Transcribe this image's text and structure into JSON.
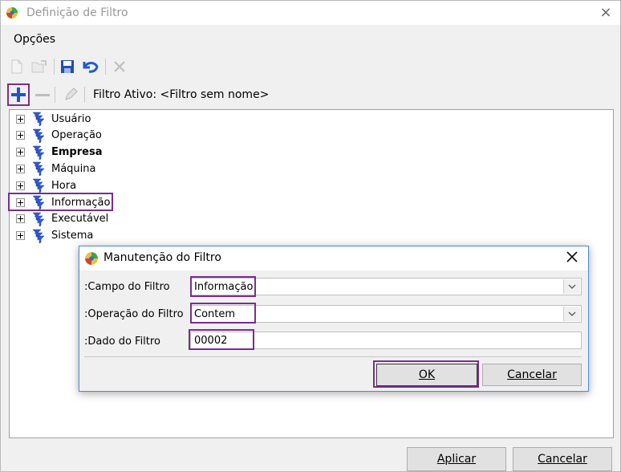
{
  "window": {
    "title": "Definição de Filtro",
    "close_icon": "×"
  },
  "menu": {
    "opcoes": "Opções"
  },
  "toolbar": {
    "icons": [
      "new-doc-icon",
      "open-icon",
      "save-icon",
      "undo-icon",
      "delete-icon"
    ]
  },
  "filter_toolbar": {
    "label": "Filtro Ativo: <Filtro sem nome>"
  },
  "tree": {
    "items": [
      {
        "label": "Usuário",
        "bold": false
      },
      {
        "label": "Operação",
        "bold": false
      },
      {
        "label": "Empresa",
        "bold": true
      },
      {
        "label": "Máquina",
        "bold": false
      },
      {
        "label": "Hora",
        "bold": false
      },
      {
        "label": "Informação",
        "bold": false
      },
      {
        "label": "Executável",
        "bold": false
      },
      {
        "label": "Sistema",
        "bold": false
      }
    ]
  },
  "dialog": {
    "title": "Manutenção do Filtro",
    "field_label": ":Campo do Filtro",
    "field_value": "Informação",
    "operation_label": ":Operação do Filtro",
    "operation_value": "Contem",
    "data_label": ":Dado do Filtro",
    "data_value": "00002",
    "ok": "OK",
    "cancel": "Cancelar"
  },
  "footer": {
    "apply": "Aplicar",
    "cancel": "Cancelar"
  },
  "colors": {
    "highlight": "#7b2d8e",
    "dialog_border": "#4a8cd6",
    "funnel_blue": "#2c5bd8"
  }
}
